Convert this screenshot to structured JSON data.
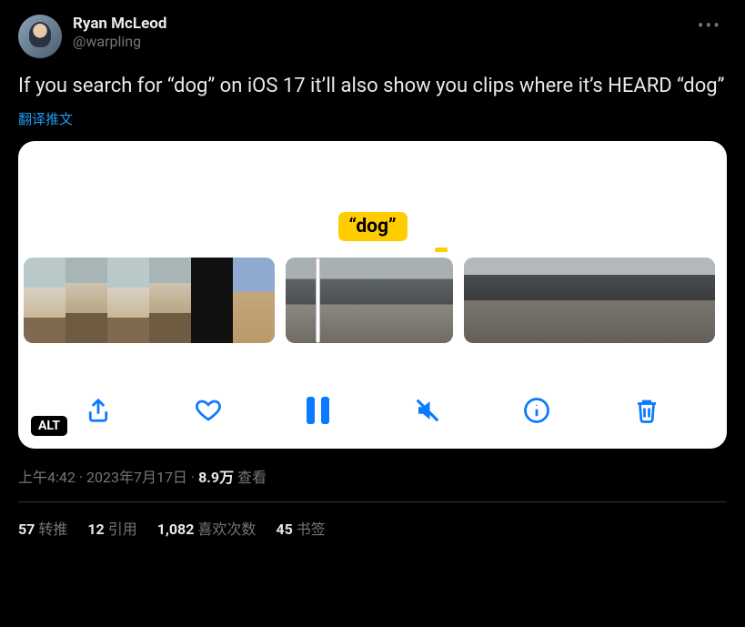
{
  "user": {
    "display_name": "Ryan McLeod",
    "handle": "@warpling"
  },
  "tweet_text": "If you search for “dog” on iOS 17 it’ll also show you clips where it’s HEARD “dog”",
  "translate_label": "翻译推文",
  "media": {
    "badge_text": "“dog”",
    "alt_label": "ALT"
  },
  "meta": {
    "time": "上午4:42",
    "date": "2023年7月17日",
    "views_count": "8.9万",
    "views_label": "查看",
    "separator": " · "
  },
  "stats": {
    "retweets": {
      "count": "57",
      "label": "转推"
    },
    "quotes": {
      "count": "12",
      "label": "引用"
    },
    "likes": {
      "count": "1,082",
      "label": "喜欢次数"
    },
    "bookmarks": {
      "count": "45",
      "label": "书签"
    }
  }
}
